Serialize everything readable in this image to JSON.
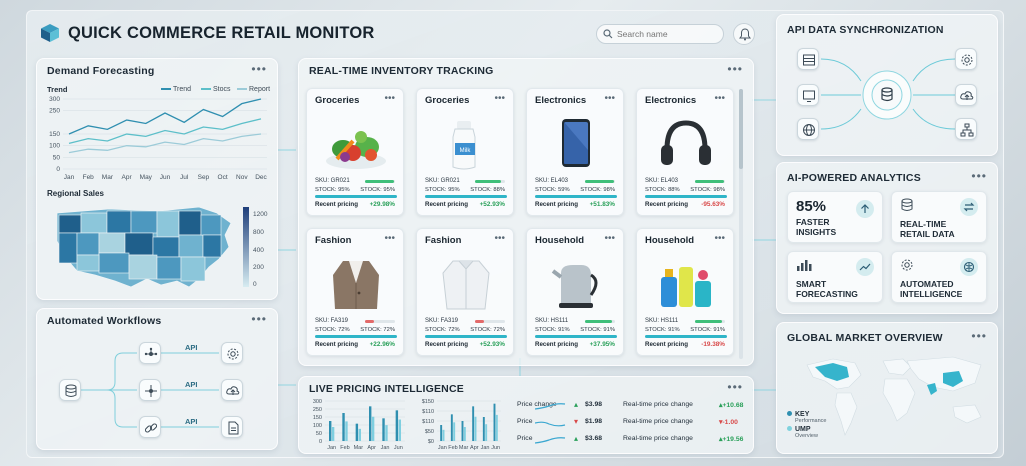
{
  "app": {
    "title": "QUICK COMMERCE RETAIL MONITOR",
    "search_placeholder": "Search name"
  },
  "menu_dots": "•••",
  "demand": {
    "title": "Demand Forecasting",
    "chart_label": "Trend",
    "legend": [
      "Trend",
      "Stocs",
      "Report"
    ],
    "regional_title": "Regional Sales",
    "map_scale": [
      "1200",
      "800",
      "400",
      "200",
      "0"
    ]
  },
  "chart_data": [
    {
      "type": "line",
      "title": "Trend",
      "categories": [
        "Jan",
        "Feb",
        "Mar",
        "Apr",
        "May",
        "Jun",
        "Jul",
        "Sep",
        "Oct",
        "Nov",
        "Dec"
      ],
      "yticks": [
        "300",
        "250",
        "150",
        "100",
        "50",
        "0"
      ],
      "ylim": [
        0,
        300
      ],
      "series": [
        {
          "name": "Trend",
          "values": [
            150,
            185,
            170,
            210,
            195,
            240,
            200,
            255,
            225,
            280,
            300
          ]
        },
        {
          "name": "Stocs",
          "values": [
            110,
            130,
            120,
            150,
            140,
            165,
            150,
            180,
            170,
            195,
            215
          ]
        },
        {
          "name": "Report",
          "values": [
            70,
            85,
            80,
            100,
            95,
            115,
            105,
            130,
            120,
            140,
            150
          ]
        }
      ],
      "colors": [
        "#2f8fb0",
        "#5cbfc9",
        "#9ccbd8"
      ]
    },
    {
      "type": "bar",
      "categories": [
        "Jan",
        "Feb",
        "Mar",
        "Apr",
        "Jan",
        "Jun"
      ],
      "yticks": [
        "300",
        "250",
        "150",
        "100",
        "50",
        "0"
      ],
      "ylim": [
        0,
        300
      ],
      "values": [
        150,
        210,
        130,
        260,
        170,
        230
      ]
    },
    {
      "type": "bar",
      "categories": [
        "Jan",
        "Feb",
        "Mar",
        "Apr",
        "Jan",
        "Jun"
      ],
      "yticks": [
        "$150",
        "$110",
        "$110",
        "$50",
        "$0"
      ],
      "ylim": [
        0,
        150
      ],
      "values": [
        60,
        100,
        75,
        130,
        90,
        140
      ]
    }
  ],
  "inventory": {
    "title": "REAL-TIME INVENTORY TRACKING",
    "cards": [
      {
        "category": "Groceries",
        "sku": "SKU: GR021",
        "stock_a": "STOCK: 95%",
        "stock_b": "STOCK: 95%",
        "level": 0.95,
        "pricing_label": "Recent pricing",
        "change": "+29.98%",
        "trend": "pos",
        "image": "vegetables"
      },
      {
        "category": "Groceries",
        "sku": "SKU: GR021",
        "stock_a": "STOCK: 95%",
        "stock_b": "STOCK: 88%",
        "level": 0.88,
        "pricing_label": "Recent pricing",
        "change": "+52.93%",
        "trend": "pos",
        "image": "milk"
      },
      {
        "category": "Electronics",
        "sku": "SKU: EL403",
        "stock_a": "STOCK: 59%",
        "stock_b": "STOCK: 98%",
        "level": 0.98,
        "pricing_label": "Recent pricing",
        "change": "+51.83%",
        "trend": "pos",
        "image": "phone"
      },
      {
        "category": "Electronics",
        "sku": "SKU: EL403",
        "stock_a": "STOCK: 88%",
        "stock_b": "STOCK: 98%",
        "level": 0.98,
        "pricing_label": "Recent pricing",
        "change": "-95.63%",
        "trend": "neg",
        "image": "headphones"
      },
      {
        "category": "Fashion",
        "sku": "SKU: FA319",
        "stock_a": "STOCK: 72%",
        "stock_b": "STOCK: 72%",
        "level": 0.3,
        "pricing_label": "Recent pricing",
        "change": "+22.96%",
        "trend": "pos",
        "image": "blazer"
      },
      {
        "category": "Fashion",
        "sku": "SKU: FA319",
        "stock_a": "STOCK: 72%",
        "stock_b": "STOCK: 72%",
        "level": 0.3,
        "pricing_label": "Recent pricing",
        "change": "+52.93%",
        "trend": "pos",
        "image": "shirt"
      },
      {
        "category": "Household",
        "sku": "SKU: HS111",
        "stock_a": "STOCK: 91%",
        "stock_b": "STOCK: 91%",
        "level": 0.91,
        "pricing_label": "Recent pricing",
        "change": "+37.95%",
        "trend": "pos",
        "image": "kettle"
      },
      {
        "category": "Household",
        "sku": "SKU: HS111",
        "stock_a": "STOCK: 91%",
        "stock_b": "STOCK: 91%",
        "level": 0.91,
        "pricing_label": "Recent pricing",
        "change": "-19.38%",
        "trend": "neg",
        "image": "cleaning"
      }
    ]
  },
  "workflows": {
    "title": "Automated Workflows",
    "api_labels": [
      "API",
      "API",
      "API"
    ]
  },
  "pricing": {
    "title": "LIVE PRICING INTELLIGENCE",
    "rows": [
      {
        "label": "Price change",
        "price": "$3.98",
        "live_label": "Real-time price change",
        "delta": "+10.68",
        "trend": "pos"
      },
      {
        "label": "Price",
        "price": "$1.98",
        "live_label": "Real-time price change",
        "delta": "-1.00",
        "trend": "neg"
      },
      {
        "label": "Price",
        "price": "$3.68",
        "live_label": "Real-time price change",
        "delta": "+19.56",
        "trend": "pos"
      }
    ]
  },
  "api_sync": {
    "title": "API DATA SYNCHRONIZATION"
  },
  "analytics": {
    "title": "AI-POWERED ANALYTICS",
    "tiles": [
      {
        "big": "85%",
        "line1": "FASTER",
        "line2": "INSIGHTS"
      },
      {
        "line1": "REAL-TIME",
        "line2": "RETAIL DATA"
      },
      {
        "line1": "SMART",
        "line2": "FORECASTING"
      },
      {
        "line1": "AUTOMATED",
        "line2": "INTELLIGENCE"
      }
    ]
  },
  "global": {
    "title": "GLOBAL MARKET OVERVIEW",
    "legend": [
      {
        "key": "KEY",
        "sub": "Performance"
      },
      {
        "key": "UMP",
        "sub": "Overview"
      }
    ]
  },
  "colors": {
    "accent": "#2fb5c8",
    "positive": "#2aa05a",
    "negative": "#d84a4a",
    "map_dark": "#1f5f8b",
    "map_light": "#a9d3e0"
  }
}
